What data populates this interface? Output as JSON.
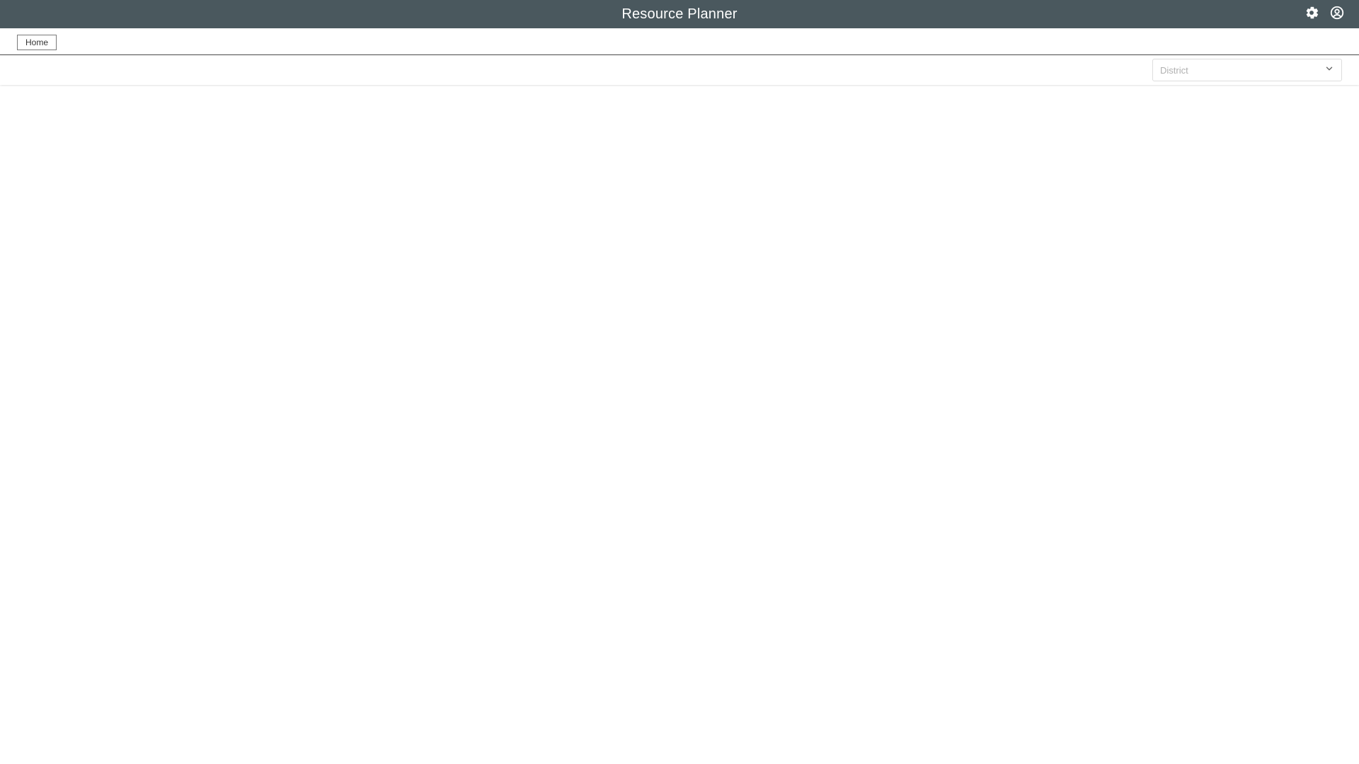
{
  "header": {
    "title": "Resource Planner",
    "bg_color": "#4a585e",
    "icons": [
      "gear-icon",
      "account-circle-icon"
    ]
  },
  "nav": {
    "home_label": "Home"
  },
  "filters": {
    "district_placeholder": "District"
  }
}
